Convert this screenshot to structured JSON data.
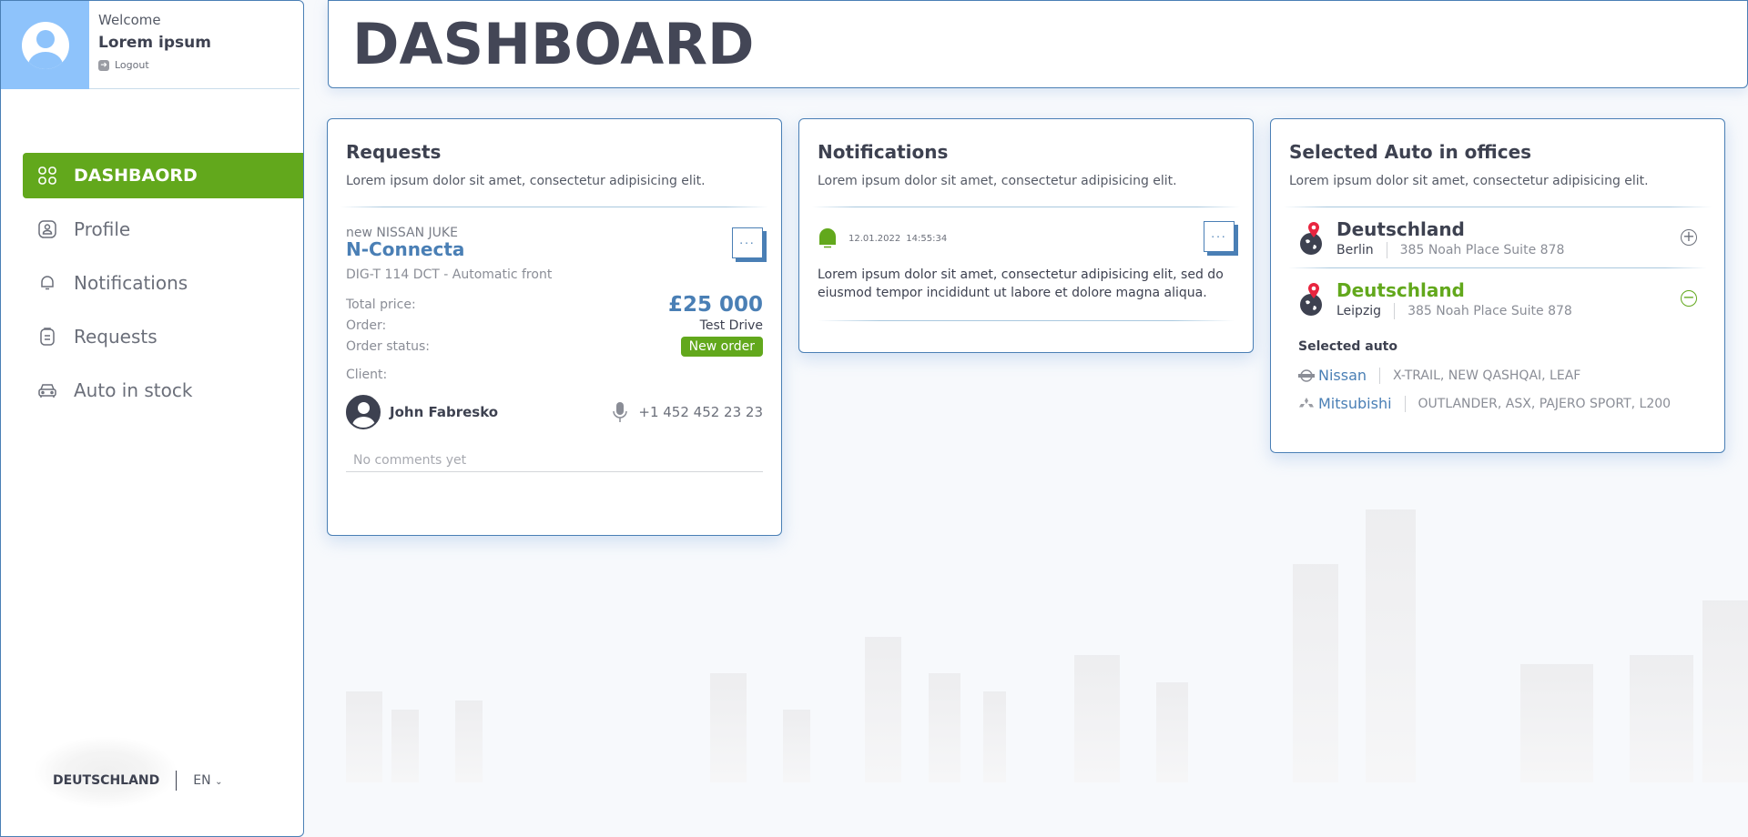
{
  "user": {
    "welcome": "Welcome",
    "name": "Lorem ipsum",
    "logout_label": "Logout"
  },
  "sidebar": {
    "items": [
      {
        "label": "DASHBAORD",
        "icon": "grid-icon",
        "active": true
      },
      {
        "label": "Profile",
        "icon": "profile-icon",
        "active": false
      },
      {
        "label": "Notifications",
        "icon": "bell-icon",
        "active": false
      },
      {
        "label": "Requests",
        "icon": "clipboard-icon",
        "active": false
      },
      {
        "label": "Auto in stock",
        "icon": "car-icon",
        "active": false
      }
    ],
    "footer": {
      "country": "DEUTSCHLAND",
      "language": "EN"
    }
  },
  "header": {
    "title": "DASHBOARD"
  },
  "requests": {
    "title": "Requests",
    "description": "Lorem ipsum dolor sit amet, consectetur adipisicing elit.",
    "car_subtitle": "new NISSAN JUKE",
    "car_name": "N-Connecta",
    "car_spec": "DIG-T 114 DCT - Automatic front",
    "more_label": "...",
    "total_price_label": "Total price:",
    "total_price": "£25 000",
    "order_label": "Order:",
    "order_value": "Test Drive",
    "status_label": "Order status:",
    "status_value": "New order",
    "client_label": "Client:",
    "client_name": "John Fabresko",
    "client_phone": "+1 452 452 23 23",
    "comment_placeholder": "No comments yet"
  },
  "notifications": {
    "title": "Notifications",
    "description": "Lorem ipsum dolor sit amet, consectetur adipisicing elit.",
    "items": [
      {
        "date": "12.01.2022",
        "time": "14:55:34",
        "text": "Lorem ipsum dolor sit amet, consectetur adipisicing elit, sed do eiusmod tempor incididunt ut labore et dolore magna aliqua."
      }
    ],
    "more_label": "..."
  },
  "selected_auto": {
    "title": "Selected Auto in offices",
    "description": "Lorem ipsum dolor sit amet, consectetur adipisicing elit.",
    "offices": [
      {
        "country": "Deutschland",
        "city": "Berlin",
        "address": "385 Noah Place Suite 878",
        "expanded": false,
        "toggle": "+"
      },
      {
        "country": "Deutschland",
        "city": "Leipzig",
        "address": "385 Noah Place Suite 878",
        "expanded": true,
        "toggle": "−"
      }
    ],
    "selected_label": "Selected auto",
    "brands": [
      {
        "name": "Nissan",
        "models": "X-TRAIL, NEW QASHQAI, LEAF",
        "logo": "nissan-logo-icon"
      },
      {
        "name": "Mitsubishi",
        "models": "OUTLANDER, ASX, PAJERO SPORT, L200",
        "logo": "mitsubishi-logo-icon"
      }
    ]
  },
  "colors": {
    "accent_green": "#62a81c",
    "accent_blue": "#4a7fb5",
    "avatar_bg": "#8ec3fb",
    "text_dark": "#3d4150",
    "pin_red": "#e8253f"
  }
}
